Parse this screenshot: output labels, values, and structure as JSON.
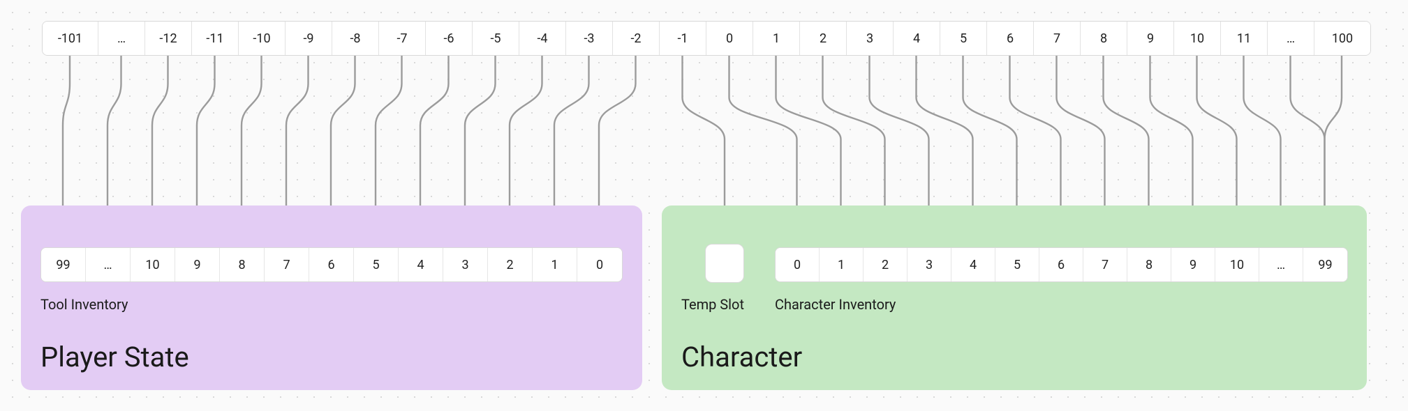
{
  "top_strip": {
    "cells": [
      "-101",
      "…",
      "-12",
      "-11",
      "-10",
      "-9",
      "-8",
      "-7",
      "-6",
      "-5",
      "-4",
      "-3",
      "-2",
      "-1",
      "0",
      "1",
      "2",
      "3",
      "4",
      "5",
      "6",
      "7",
      "8",
      "9",
      "10",
      "11",
      "…",
      "100"
    ]
  },
  "player_state": {
    "title": "Player State",
    "tool_inventory_label": "Tool Inventory",
    "tool_cells": [
      "99",
      "…",
      "10",
      "9",
      "8",
      "7",
      "6",
      "5",
      "4",
      "3",
      "2",
      "1",
      "0"
    ]
  },
  "character": {
    "title": "Character",
    "temp_slot_label": "Temp Slot",
    "inventory_label": "Character Inventory",
    "inventory_cells": [
      "0",
      "1",
      "2",
      "3",
      "4",
      "5",
      "6",
      "7",
      "8",
      "9",
      "10",
      "…",
      "99"
    ]
  },
  "colors": {
    "purple_panel": "#e3ccf4",
    "green_panel": "#c4e8c2",
    "arrow": "#9b9b9b",
    "cell_border": "#e2e2e2"
  }
}
